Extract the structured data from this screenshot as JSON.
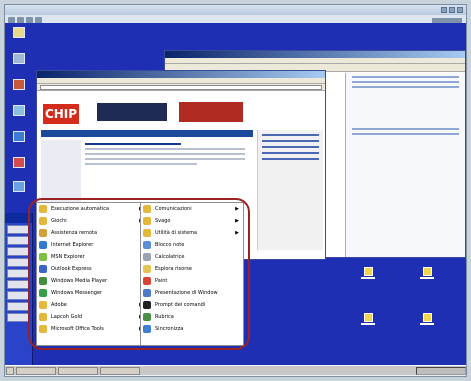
{
  "colors": {
    "desktop": "#1f2fb4",
    "highlight": "#9b2222",
    "chip_red": "#d42b1a"
  },
  "host": {
    "title": "",
    "toolbar_icons": [
      "back-icon",
      "forward-icon",
      "refresh-icon",
      "settings-icon"
    ]
  },
  "chip": {
    "logo": "CHIP",
    "banner": "",
    "red_banner": ""
  },
  "programs_menu": {
    "items": [
      {
        "label": "Esecuzione automatica",
        "icon": "folder-icon",
        "has_submenu": true,
        "color": "#e2b93b"
      },
      {
        "label": "Giochi",
        "icon": "folder-icon",
        "has_submenu": true,
        "color": "#e2b93b"
      },
      {
        "label": "Assistenza remota",
        "icon": "remote-assistance-icon",
        "has_submenu": false,
        "color": "#d3a03a"
      },
      {
        "label": "Internet Explorer",
        "icon": "internet-explorer-icon",
        "has_submenu": false,
        "color": "#2f79d1"
      },
      {
        "label": "MSN Explorer",
        "icon": "msn-icon",
        "has_submenu": false,
        "color": "#7ac143"
      },
      {
        "label": "Outlook Express",
        "icon": "outlook-icon",
        "has_submenu": false,
        "color": "#3a64c5"
      },
      {
        "label": "Windows Media Player",
        "icon": "media-player-icon",
        "has_submenu": false,
        "color": "#3e8f3e"
      },
      {
        "label": "Windows Messenger",
        "icon": "messenger-icon",
        "has_submenu": false,
        "color": "#35a04a"
      },
      {
        "label": "Adobe",
        "icon": "folder-icon",
        "has_submenu": true,
        "color": "#e2b93b"
      },
      {
        "label": "Lapcoh Gold",
        "icon": "folder-icon",
        "has_submenu": true,
        "color": "#e2b93b"
      },
      {
        "label": "Microsoft Office Tools",
        "icon": "folder-icon",
        "has_submenu": true,
        "color": "#e2b93b"
      }
    ]
  },
  "accessories_menu": {
    "items": [
      {
        "label": "Comunicazioni",
        "icon": "folder-icon",
        "has_submenu": true,
        "color": "#e2b93b"
      },
      {
        "label": "Svago",
        "icon": "folder-icon",
        "has_submenu": true,
        "color": "#e2b93b"
      },
      {
        "label": "Utilità di sistema",
        "icon": "folder-icon",
        "has_submenu": true,
        "color": "#e2b93b"
      },
      {
        "label": "Blocco note",
        "icon": "notepad-icon",
        "has_submenu": false,
        "color": "#5c8fd6"
      },
      {
        "label": "Calcolatrice",
        "icon": "calculator-icon",
        "has_submenu": false,
        "color": "#9aa4b1"
      },
      {
        "label": "Esplora risorse",
        "icon": "explorer-icon",
        "has_submenu": false,
        "color": "#e3c453"
      },
      {
        "label": "Paint",
        "icon": "paint-icon",
        "has_submenu": false,
        "color": "#d9443a"
      },
      {
        "label": "Presentazione di Window",
        "icon": "presentation-icon",
        "has_submenu": false,
        "color": "#4f7ac8"
      },
      {
        "label": "Prompt dei comandi",
        "icon": "command-prompt-icon",
        "has_submenu": false,
        "color": "#222222"
      },
      {
        "label": "Rubrica",
        "icon": "address-book-icon",
        "has_submenu": false,
        "color": "#4b8f45"
      },
      {
        "label": "Sincronizza",
        "icon": "sync-icon",
        "has_submenu": false,
        "color": "#3f7fcf"
      }
    ]
  }
}
